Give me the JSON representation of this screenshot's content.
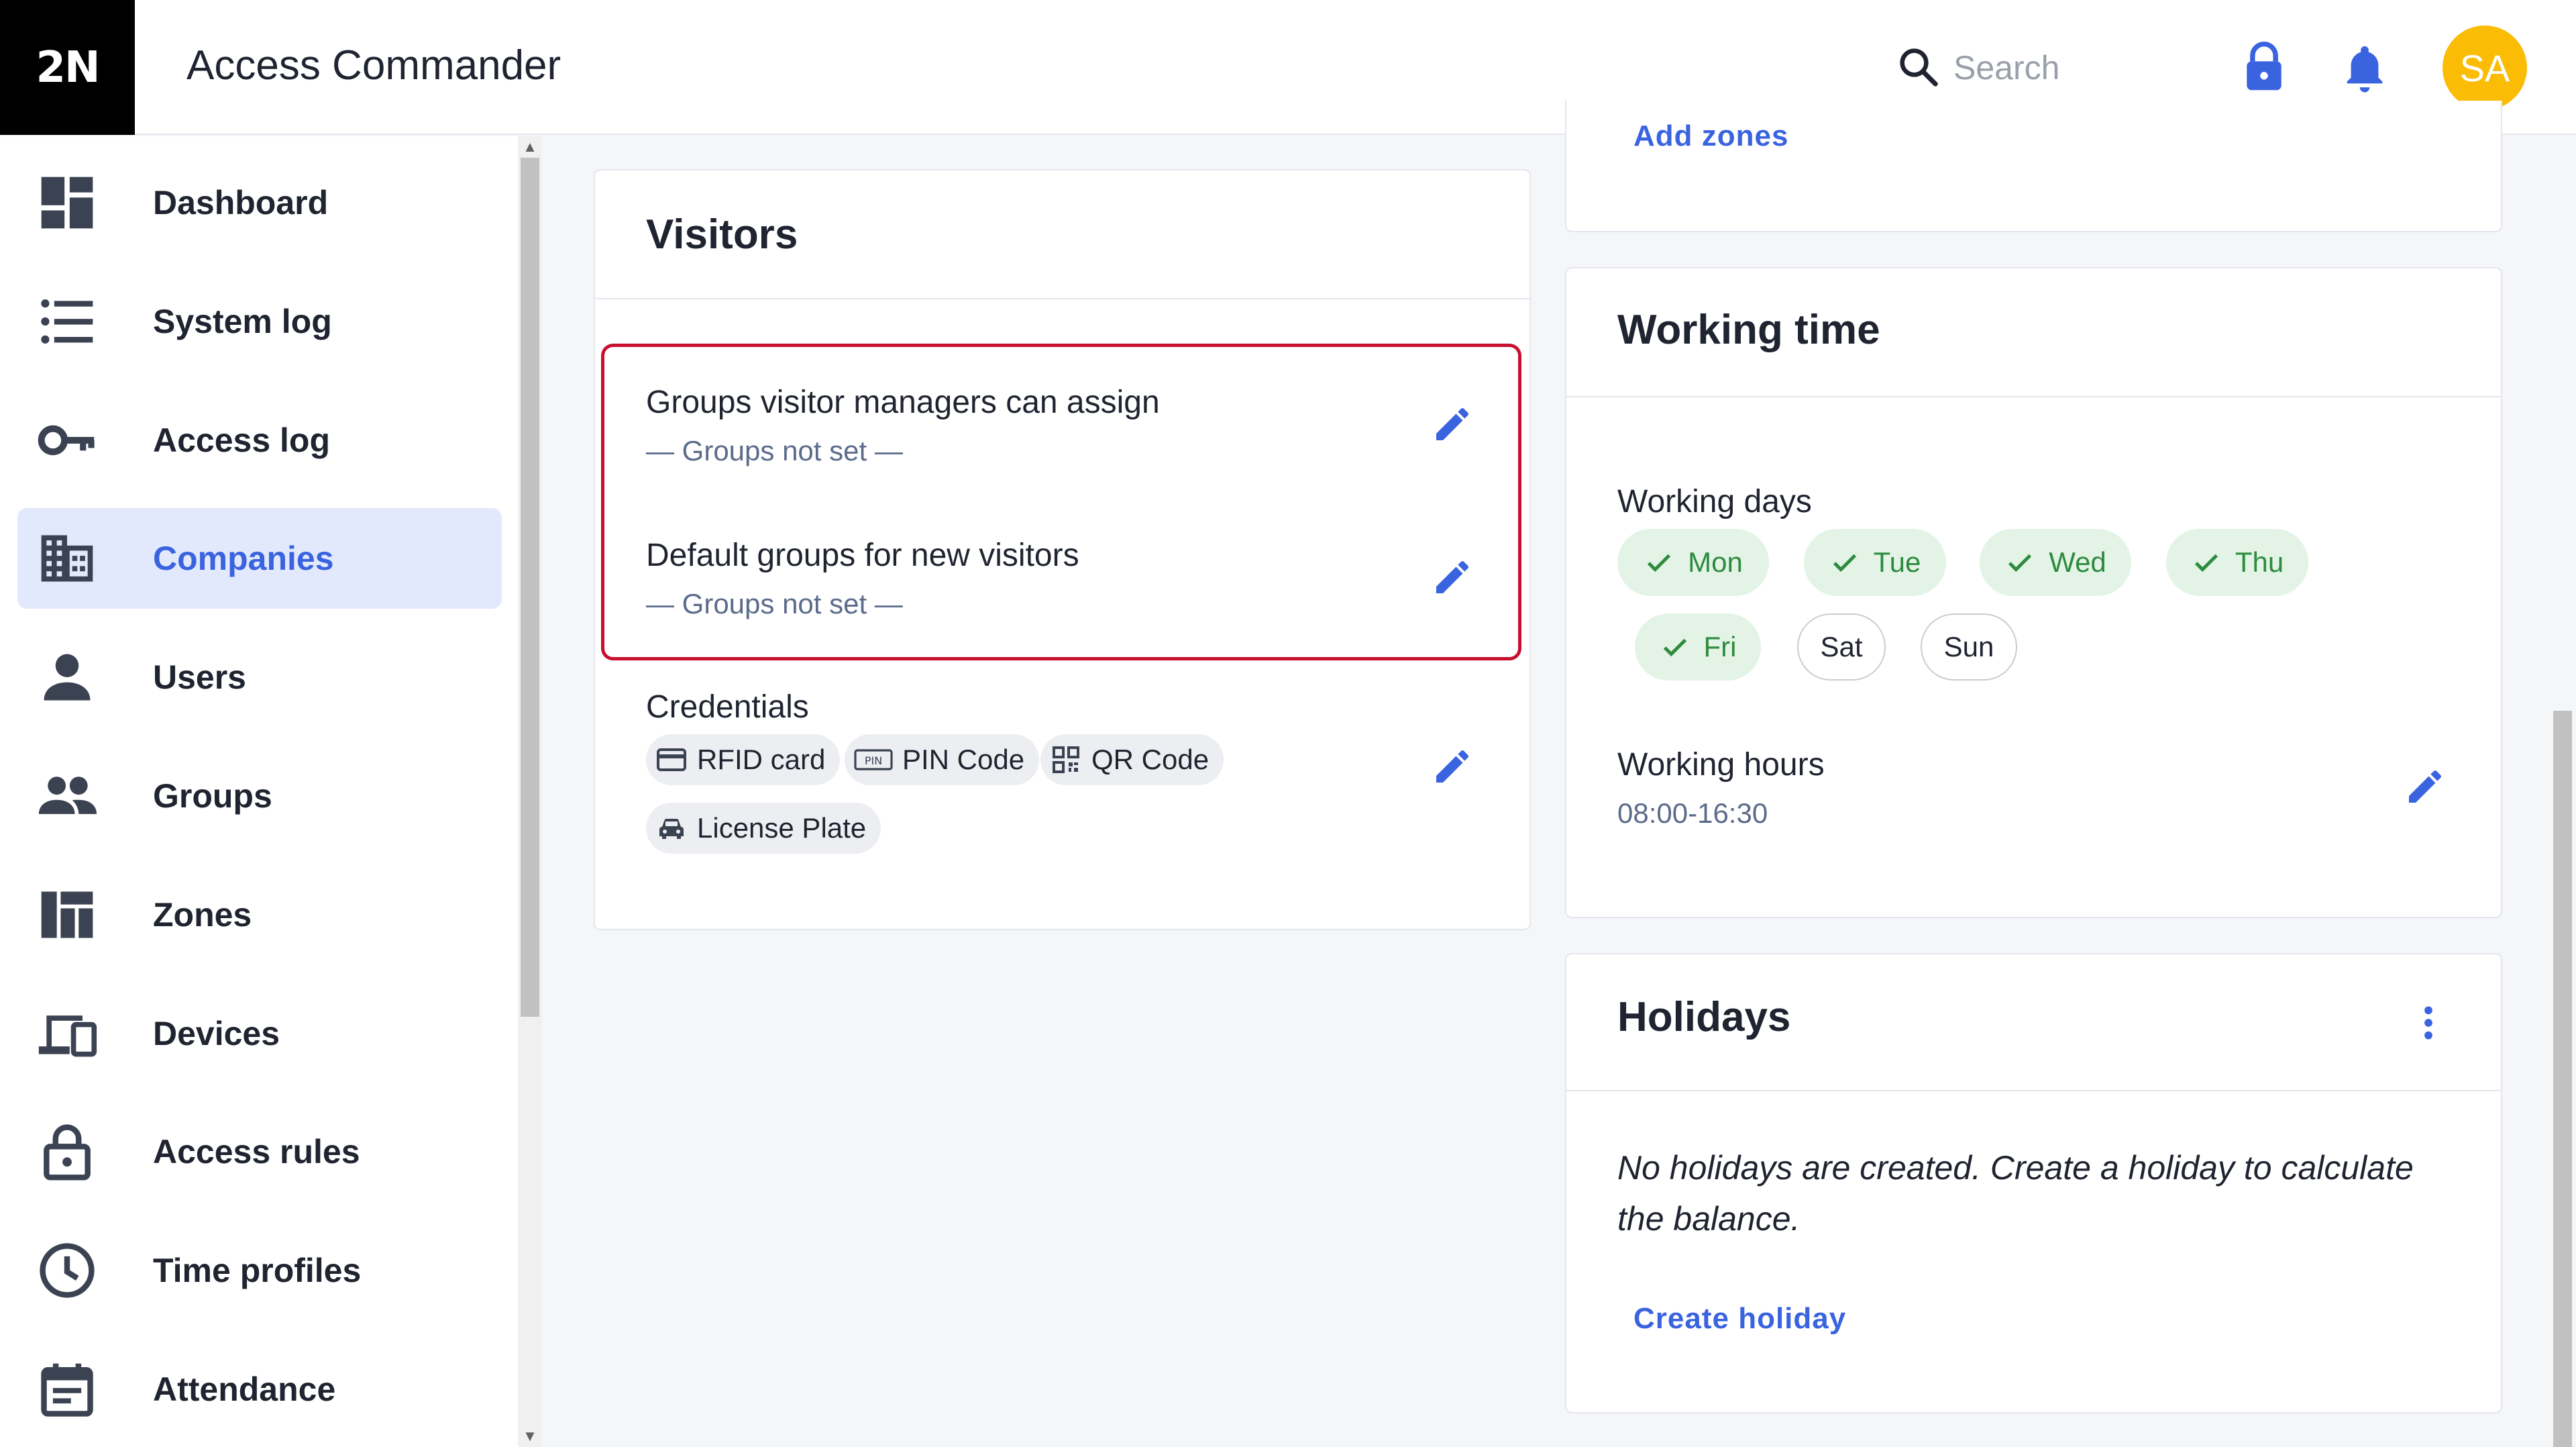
{
  "header": {
    "logo": "2N",
    "app_title": "Access Commander",
    "search_placeholder": "Search",
    "avatar_initials": "SA"
  },
  "sidebar": {
    "items": [
      {
        "label": "Dashboard",
        "icon": "dashboard-icon"
      },
      {
        "label": "System log",
        "icon": "list-icon"
      },
      {
        "label": "Access log",
        "icon": "key-icon"
      },
      {
        "label": "Companies",
        "icon": "building-icon",
        "active": true
      },
      {
        "label": "Users",
        "icon": "person-icon"
      },
      {
        "label": "Groups",
        "icon": "people-icon"
      },
      {
        "label": "Zones",
        "icon": "zones-icon"
      },
      {
        "label": "Devices",
        "icon": "devices-icon"
      },
      {
        "label": "Access rules",
        "icon": "lock-icon"
      },
      {
        "label": "Time profiles",
        "icon": "clock-icon"
      },
      {
        "label": "Attendance",
        "icon": "calendar-icon"
      }
    ]
  },
  "zones_card": {
    "link": "Add zones"
  },
  "visitors": {
    "title": "Visitors",
    "groups_assign_label": "Groups visitor managers can assign",
    "groups_assign_value": "— Groups not set —",
    "default_groups_label": "Default groups for new visitors",
    "default_groups_value": "— Groups not set —",
    "credentials_label": "Credentials",
    "credentials": [
      {
        "label": "RFID card",
        "icon": "card-icon"
      },
      {
        "label": "PIN Code",
        "icon": "pin-icon"
      },
      {
        "label": "QR Code",
        "icon": "qr-icon"
      },
      {
        "label": "License Plate",
        "icon": "car-icon"
      }
    ]
  },
  "working_time": {
    "title": "Working time",
    "working_days_label": "Working days",
    "days": [
      {
        "label": "Mon",
        "on": true
      },
      {
        "label": "Tue",
        "on": true
      },
      {
        "label": "Wed",
        "on": true
      },
      {
        "label": "Thu",
        "on": true
      },
      {
        "label": "Fri",
        "on": true
      },
      {
        "label": "Sat",
        "on": false
      },
      {
        "label": "Sun",
        "on": false
      }
    ],
    "working_hours_label": "Working hours",
    "working_hours_value": "08:00-16:30"
  },
  "holidays": {
    "title": "Holidays",
    "empty_text_line1": "No holidays are created. Create a holiday to calculate",
    "empty_text_line2": "the balance.",
    "create_link": "Create holiday"
  },
  "colors": {
    "accent": "#3a63e0",
    "active_bg": "#e3e9fc",
    "highlight": "#c8102e",
    "day_on_bg": "#e3f4e6",
    "day_on_text": "#2e8b3e",
    "avatar": "#fbbc05"
  }
}
